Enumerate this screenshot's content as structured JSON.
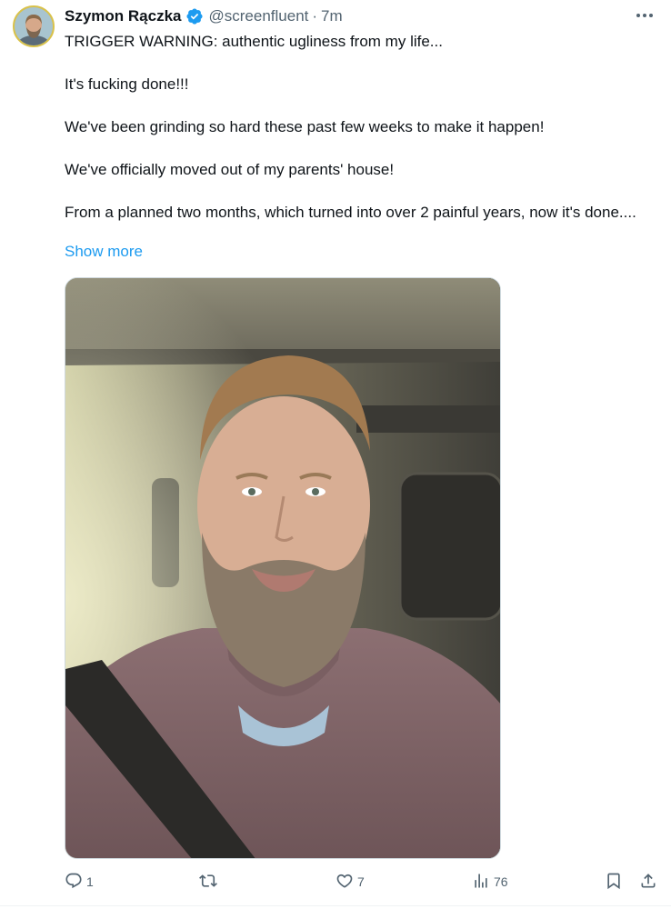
{
  "author": {
    "name": "Szymon Rączka",
    "handle": "@screenfluent",
    "separator": "·",
    "time": "7m"
  },
  "tweet": {
    "paragraphs": [
      "TRIGGER WARNING: authentic ugliness from my life...",
      "It's fucking done!!!",
      "We've been grinding so hard these past few weeks to make it happen!",
      "We've officially moved out of my parents' house!",
      "From a planned two months, which turned into over 2 painful years, now it's done...."
    ],
    "show_more_label": "Show more"
  },
  "actions": {
    "reply_count": "1",
    "repost_count": "",
    "like_count": "7",
    "views_count": "76"
  },
  "colors": {
    "accent": "#1d9bf0",
    "muted": "#536471",
    "text": "#0f1419"
  },
  "icons": [
    "verified-badge-icon",
    "more-dots-icon",
    "reply-icon",
    "repost-icon",
    "like-icon",
    "views-icon",
    "bookmark-icon",
    "share-icon"
  ]
}
